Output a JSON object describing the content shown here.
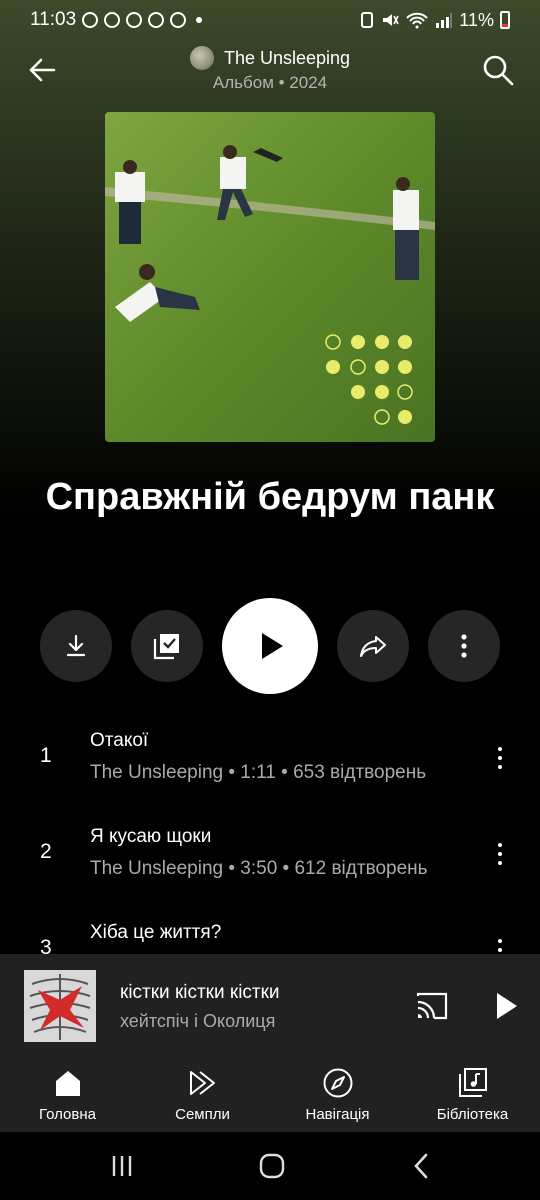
{
  "status_bar": {
    "time": "11:03",
    "battery": "11%"
  },
  "header": {
    "artist": "The Unsleeping",
    "meta": "Альбом • 2024"
  },
  "album": {
    "title": "Справжній бедрум панк"
  },
  "tracks": [
    {
      "num": "1",
      "title": "Отакої",
      "subtitle": "The Unsleeping • 1:11 • 653 відтворень"
    },
    {
      "num": "2",
      "title": "Я кусаю щоки",
      "subtitle": "The Unsleeping • 3:50 • 612 відтворень"
    },
    {
      "num": "3",
      "title": "Хіба це життя?",
      "subtitle": ""
    }
  ],
  "now_playing": {
    "title": "кістки кістки кістки",
    "artist": "хейтспіч і Околиця"
  },
  "nav": [
    {
      "label": "Головна",
      "icon": "home-icon"
    },
    {
      "label": "Семпли",
      "icon": "samples-icon"
    },
    {
      "label": "Навігація",
      "icon": "compass-icon"
    },
    {
      "label": "Бібліотека",
      "icon": "library-icon"
    }
  ],
  "colors": {
    "background": "#000000",
    "surface": "#212121",
    "button": "#262626",
    "secondary_text": "#aaaaaa"
  }
}
